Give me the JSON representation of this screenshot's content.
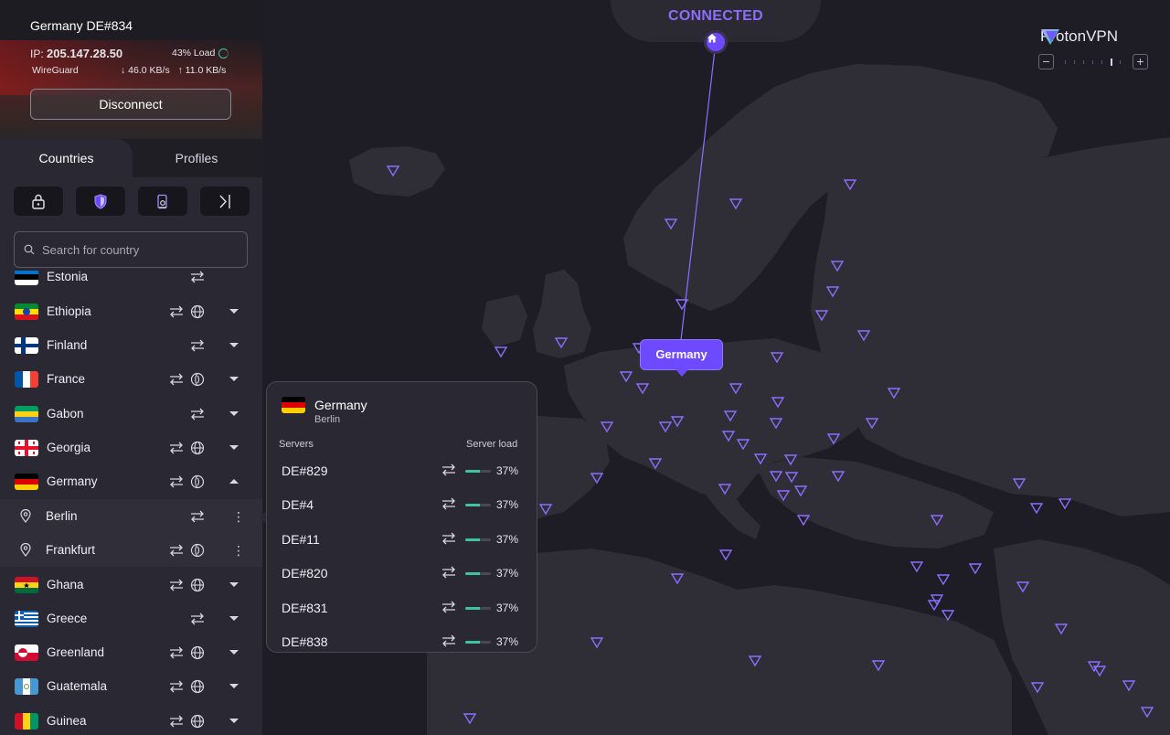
{
  "app": {
    "brand": "ProtonVPN"
  },
  "connection": {
    "status": "CONNECTED",
    "server": "Germany DE#834",
    "ip_label": "IP:",
    "ip": "205.147.28.50",
    "load": "43% Load",
    "protocol": "WireGuard",
    "download": "46.0 KB/s",
    "upload": "11.0 KB/s",
    "disconnect_label": "Disconnect"
  },
  "tabs": {
    "countries": "Countries",
    "profiles": "Profiles"
  },
  "filters": [
    {
      "icon": "lock-icon"
    },
    {
      "icon": "shield-icon"
    },
    {
      "icon": "tor-icon"
    },
    {
      "icon": "p2p-icon"
    }
  ],
  "search": {
    "placeholder": "Search for country"
  },
  "countries": [
    {
      "name": "Estonia"
    },
    {
      "name": "Ethiopia",
      "flag": "ethiopia",
      "icons": [
        "p2p-arrows-icon",
        "globe-icon"
      ]
    },
    {
      "name": "Finland",
      "flag": "finland",
      "icons": [
        "p2p-arrows-icon"
      ]
    },
    {
      "name": "France",
      "flag": "france",
      "icons": [
        "p2p-arrows-icon",
        "tor-onion-icon"
      ]
    },
    {
      "name": "Gabon",
      "flag": "gabon",
      "icons": [
        "p2p-arrows-icon"
      ]
    },
    {
      "name": "Georgia",
      "flag": "georgia",
      "icons": [
        "p2p-arrows-icon",
        "globe-icon"
      ]
    },
    {
      "name": "Germany",
      "flag": "germany",
      "icons": [
        "p2p-arrows-icon",
        "tor-onion-icon"
      ],
      "expanded": true
    },
    {
      "name": "Berlin",
      "city": true,
      "icons": [
        "p2p-arrows-icon"
      ]
    },
    {
      "name": "Frankfurt",
      "city": true,
      "icons": [
        "p2p-arrows-icon",
        "tor-onion-icon"
      ]
    },
    {
      "name": "Ghana",
      "flag": "ghana",
      "icons": [
        "p2p-arrows-icon",
        "globe-icon"
      ]
    },
    {
      "name": "Greece",
      "flag": "greece",
      "icons": [
        "p2p-arrows-icon"
      ]
    },
    {
      "name": "Greenland",
      "flag": "greenland",
      "icons": [
        "p2p-arrows-icon",
        "globe-icon"
      ]
    },
    {
      "name": "Guatemala",
      "flag": "guatemala",
      "icons": [
        "p2p-arrows-icon",
        "globe-icon"
      ]
    },
    {
      "name": "Guinea",
      "flag": "guinea",
      "icons": [
        "p2p-arrows-icon",
        "globe-icon"
      ]
    }
  ],
  "popover": {
    "country": "Germany",
    "city": "Berlin",
    "servers_header": "Servers",
    "load_header": "Server load",
    "servers": [
      {
        "name": "DE#829",
        "load": "37%",
        "load_fraction": 0.37
      },
      {
        "name": "DE#4",
        "load": "37%",
        "load_fraction": 0.37
      },
      {
        "name": "DE#11",
        "load": "37%",
        "load_fraction": 0.37
      },
      {
        "name": "DE#820",
        "load": "37%",
        "load_fraction": 0.37
      },
      {
        "name": "DE#831",
        "load": "37%",
        "load_fraction": 0.37
      },
      {
        "name": "DE#838",
        "load": "37%",
        "load_fraction": 0.37
      }
    ]
  },
  "map": {
    "tooltip": "Germany"
  },
  "colors": {
    "accent": "#6d4aff",
    "accent_light": "#8a6eff",
    "load_green": "#3fc3a4",
    "sidebar_bg": "#2a2933",
    "map_bg": "#1e1d25"
  }
}
